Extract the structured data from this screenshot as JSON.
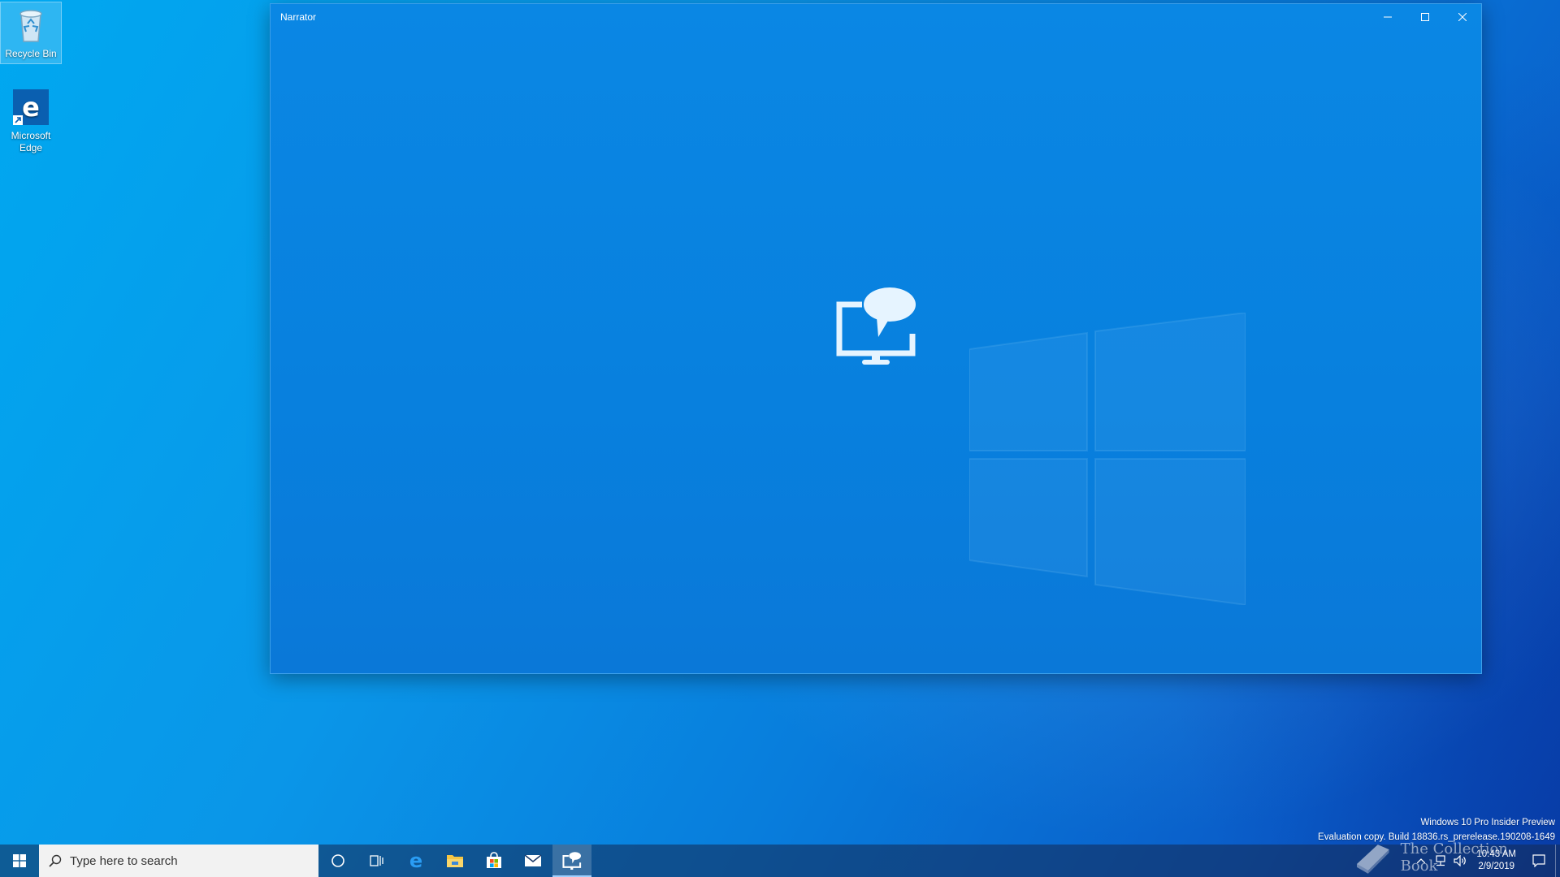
{
  "desktop": {
    "icons": [
      {
        "label": "Recycle Bin",
        "icon": "recycle-bin-icon"
      },
      {
        "label": "Microsoft Edge",
        "icon": "edge-icon"
      }
    ]
  },
  "window": {
    "title": "Narrator",
    "controls": {
      "minimize": "minimize-icon",
      "maximize": "maximize-icon",
      "close": "close-icon"
    },
    "hero_icon": "narrator-icon"
  },
  "watermark": {
    "line1": "Windows 10 Pro Insider Preview",
    "line2": "Evaluation copy. Build 18836.rs_prerelease.190208-1649"
  },
  "taskbar": {
    "search_placeholder": "Type here to search",
    "apps": [
      "cortana-icon",
      "task-view-icon",
      "edge-icon",
      "file-explorer-icon",
      "store-icon",
      "mail-icon",
      "narrator-icon"
    ],
    "active_app": "Narrator",
    "clock": {
      "time": "10:43 AM",
      "date": "2/9/2019"
    }
  },
  "overlay": {
    "text": "The Collection Book"
  },
  "colors": {
    "accent": "#0a87e4",
    "taskbar": "#1b3a6a"
  }
}
